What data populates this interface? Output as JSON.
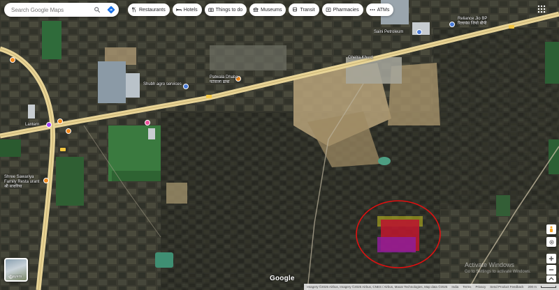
{
  "search": {
    "placeholder": "Search Google Maps"
  },
  "chips": [
    {
      "label": "Restaurants",
      "icon": "fork-knife-icon"
    },
    {
      "label": "Hotels",
      "icon": "bed-icon"
    },
    {
      "label": "Things to do",
      "icon": "camera-icon"
    },
    {
      "label": "Museums",
      "icon": "museum-icon"
    },
    {
      "label": "Transit",
      "icon": "bus-icon"
    },
    {
      "label": "Pharmacies",
      "icon": "pill-icon"
    },
    {
      "label": "ATMs",
      "icon": "dots-icon"
    }
  ],
  "places": {
    "shree_sawariya": "Shree Sawariya",
    "shree_sawariya_2": "Family Resta urant",
    "shree_sawariya_3": "श्री सावरिया",
    "patwala_dhaba": "Patwala Dhaba",
    "patwala_dhaba_sub": "पटवाला ढाबा",
    "shubh_agro": "Shubh agro services",
    "lantern": "Lantern",
    "reliance": "Reliance Jio BP",
    "reliance_sub": "रिलायंस जियो बीपी",
    "sarpanch": "Saini Petroleum",
    "village": "Ghelra Khurd"
  },
  "layers": {
    "label": "Layers"
  },
  "google_logo": "Google",
  "watermark": {
    "title": "Activate Windows",
    "subtitle": "Go to Settings to activate Windows."
  },
  "attribution": {
    "imagery": "Imagery ©2025 Airbus, Imagery ©2025 Airbus, CNES / Airbus, Maxar Technologies, Map data ©2025",
    "india": "India",
    "terms": "Terms",
    "privacy": "Privacy",
    "feedback": "Send Product Feedback",
    "scale": "200 m"
  },
  "colors": {
    "heat_red": "#b8182e",
    "heat_magenta": "#8e1e9a",
    "heat_yellow": "#c9c21e",
    "circle_red": "#e01010",
    "road_yellow": "#f2d98a",
    "pin_orange": "#f28b1e",
    "pin_purple": "#a142f4",
    "pin_pink": "#ec4f9b",
    "pin_blue": "#4a7bd8",
    "accent_blue": "#1a73e8"
  }
}
